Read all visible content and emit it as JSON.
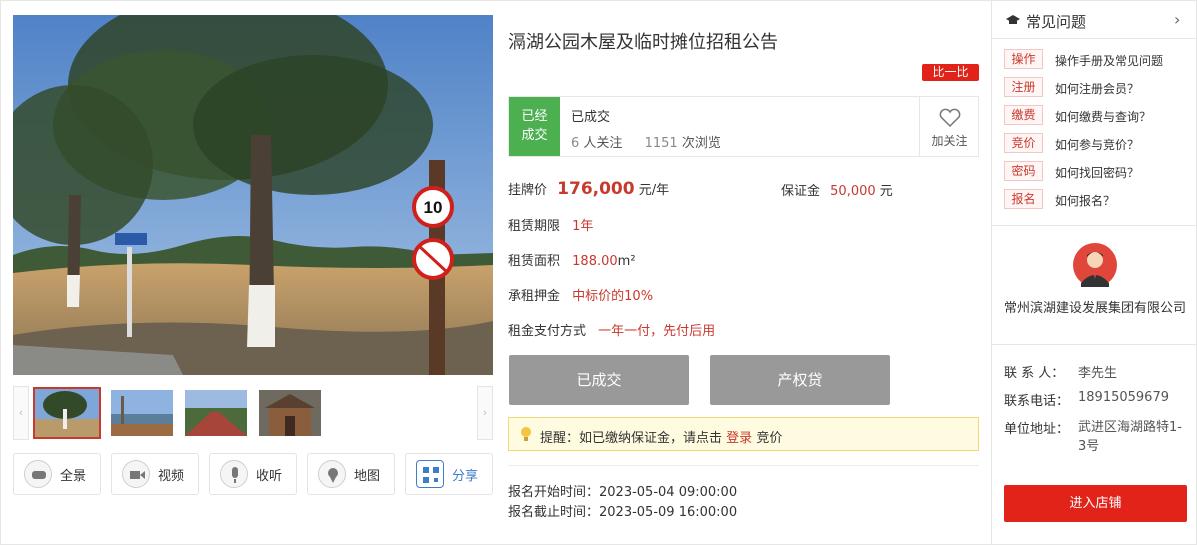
{
  "listing": {
    "title": "滆湖公园木屋及临时摊位招租公告",
    "compare_label": "比一比",
    "status_badge_line1": "已经",
    "status_badge_line2": "成交",
    "status_text": "已成交",
    "followers_count": "6",
    "followers_unit": "人关注",
    "views_count": "1151",
    "views_unit": "次浏览",
    "follow_label": "加关注",
    "listing_price_label": "挂牌价",
    "listing_price_value": "176,000",
    "listing_price_unit": "元/年",
    "deposit_label": "保证金",
    "deposit_value": "50,000",
    "deposit_unit": "元",
    "lease_term_label": "租赁期限",
    "lease_term_value": "1年",
    "area_label": "租赁面积",
    "area_value": "188.00",
    "area_unit": "m²",
    "pledge_label": "承租押金",
    "pledge_value": "中标价的10%",
    "payment_label": "租金支付方式",
    "payment_value": "一年一付，先付后用",
    "btn_deal": "已成交",
    "btn_loan": "产权贷",
    "notice_prefix": "提醒：如已缴纳保证金，请点击",
    "notice_link": "登录",
    "notice_suffix": "竞价",
    "signup_start_label": "报名开始时间：",
    "signup_start_value": "2023-05-04 09:00:00",
    "signup_end_label": "报名截止时间：",
    "signup_end_value": "2023-05-09 16:00:00"
  },
  "gallery": {
    "sign_text": "10",
    "tools": [
      "全景",
      "视频",
      "收听",
      "地图",
      "分享"
    ]
  },
  "faq": {
    "title": "常见问题",
    "items": [
      {
        "tag": "操作",
        "question": "操作手册及常见问题"
      },
      {
        "tag": "注册",
        "question": "如何注册会员？"
      },
      {
        "tag": "缴费",
        "question": "如何缴费与查询？"
      },
      {
        "tag": "竞价",
        "question": "如何参与竞价？"
      },
      {
        "tag": "密码",
        "question": "如何找回密码？"
      },
      {
        "tag": "报名",
        "question": "如何报名？"
      }
    ]
  },
  "seller": {
    "company": "常州滨湖建设发展集团有限公司",
    "contact_label": "联 系 人：",
    "contact_value": "李先生",
    "phone_label": "联系电话：",
    "phone_value": "18915059679",
    "address_label": "单位地址：",
    "address_value": "武进区海湖路特1-3号",
    "enter_store": "进入店铺"
  },
  "colors": {
    "accent_red": "#c8392e",
    "status_green": "#4caf50",
    "button_gray": "#999999"
  }
}
